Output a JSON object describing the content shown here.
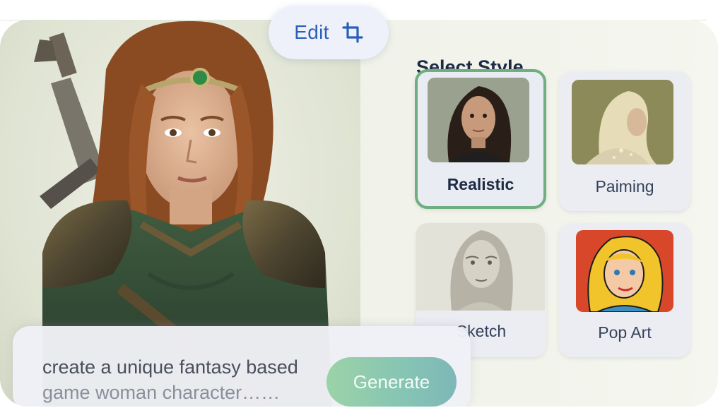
{
  "edit": {
    "label": "Edit",
    "icon": "crop-icon"
  },
  "style_panel": {
    "title": "Select Style",
    "selected": "Realistic",
    "options": [
      {
        "label": "Realistic"
      },
      {
        "label": "Paiming"
      },
      {
        "label": "Sketch"
      },
      {
        "label": "Pop Art"
      }
    ]
  },
  "prompt": {
    "line1": "create a unique fantasy based",
    "line2": "game woman character……",
    "generate_label": "Generate"
  },
  "colors": {
    "accent_blue": "#2b5fb8",
    "selected_border": "#6fae7e",
    "generate_gradient_start": "#9bd3a7",
    "generate_gradient_end": "#7eb7b8"
  }
}
